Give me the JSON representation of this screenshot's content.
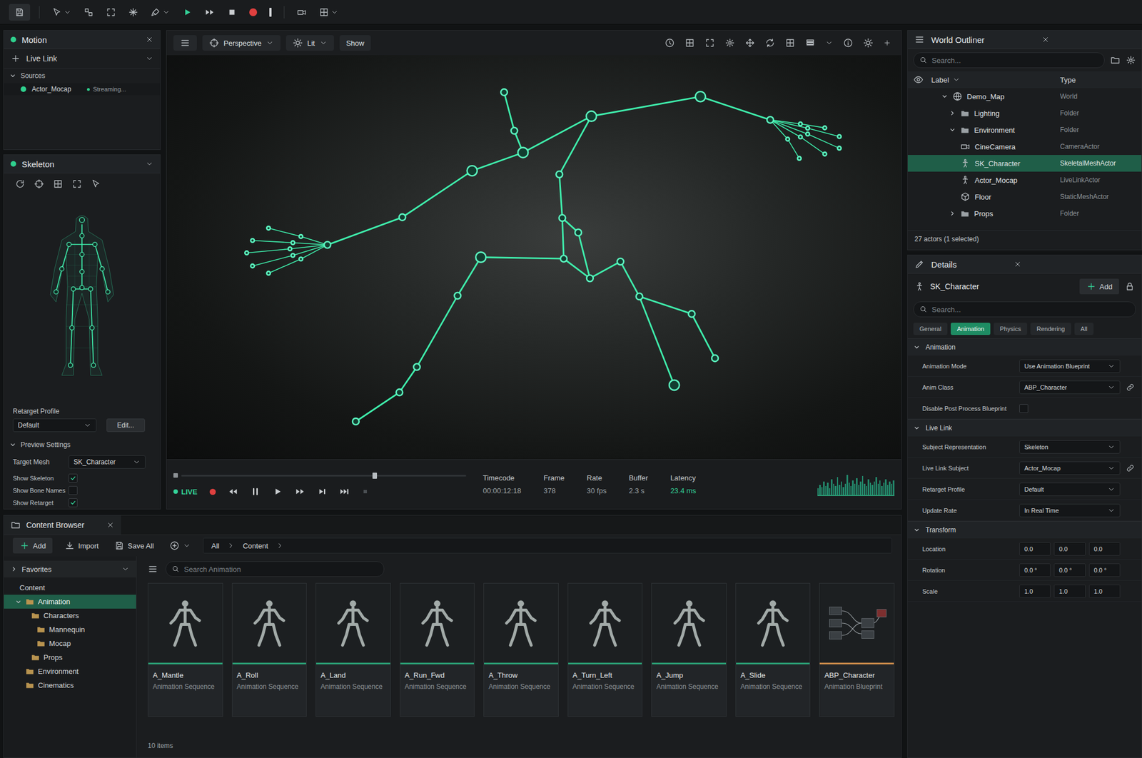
{
  "motion": {
    "title": "Motion",
    "live_link": "Live Link",
    "sources_title": "Sources",
    "sources_expanded": true,
    "sources": [
      {
        "name": "Actor_Mocap",
        "status": "Streaming...",
        "color": "#2fd18e"
      }
    ]
  },
  "skeleton": {
    "title": "Skeleton",
    "retarget_label": "Retarget Profile",
    "retarget_value": "Default",
    "edit_button": "Edit...",
    "preview_title": "Preview Settings",
    "preview_expanded": true,
    "target_mesh_label": "Target Mesh",
    "target_mesh": "SK_Character",
    "toggles": [
      {
        "label": "Show Skeleton",
        "checked": true
      },
      {
        "label": "Show Bone Names",
        "checked": false
      },
      {
        "label": "Show Retarget",
        "checked": true
      }
    ]
  },
  "viewport": {
    "view_mode": "Perspective",
    "lighting": "Lit",
    "show": "Show",
    "live_label": "LIVE",
    "live": true,
    "playhead": 0.68,
    "stats": [
      {
        "label": "Timecode",
        "value": "00:00:12:18",
        "highlight": false
      },
      {
        "label": "Frame",
        "value": "378",
        "highlight": false
      },
      {
        "label": "Rate",
        "value": "30 fps",
        "highlight": false
      },
      {
        "label": "Buffer",
        "value": "2.3 s",
        "highlight": false
      },
      {
        "label": "Latency",
        "value": "23.4 ms",
        "highlight": true
      }
    ],
    "activity": [
      0.3,
      0.45,
      0.35,
      0.6,
      0.4,
      0.55,
      0.3,
      0.7,
      0.5,
      0.4,
      0.8,
      0.45,
      0.6,
      0.35,
      0.5,
      0.9,
      0.55,
      0.4,
      0.65,
      0.5,
      0.75,
      0.45,
      0.6,
      0.85,
      0.5,
      0.4,
      0.7,
      0.55,
      0.45,
      0.6,
      0.8,
      0.5,
      0.65,
      0.4,
      0.55,
      0.7,
      0.45,
      0.6,
      0.5,
      0.65
    ]
  },
  "outliner": {
    "title": "World Outliner",
    "search_placeholder": "Search...",
    "columns": [
      "Label",
      "Type"
    ],
    "rows": [
      {
        "label": "Demo_Map",
        "type": "World",
        "kind": "world",
        "depth": 0,
        "expandable": true,
        "expanded": true,
        "selected": false
      },
      {
        "label": "Lighting",
        "type": "Folder",
        "kind": "folder",
        "depth": 1,
        "expandable": true,
        "expanded": false,
        "selected": false
      },
      {
        "label": "Environment",
        "type": "Folder",
        "kind": "folder",
        "depth": 1,
        "expandable": true,
        "expanded": true,
        "selected": false
      },
      {
        "label": "CineCamera",
        "type": "CameraActor",
        "kind": "camera",
        "depth": 1,
        "expandable": false,
        "expanded": false,
        "selected": false
      },
      {
        "label": "SK_Character",
        "type": "SkeletalMeshActor",
        "kind": "skeletal",
        "depth": 1,
        "expandable": false,
        "expanded": false,
        "selected": true
      },
      {
        "label": "Actor_Mocap",
        "type": "LiveLinkActor",
        "kind": "livelink",
        "depth": 1,
        "expandable": false,
        "expanded": false,
        "selected": false
      },
      {
        "label": "Floor",
        "type": "StaticMeshActor",
        "kind": "mesh",
        "depth": 1,
        "expandable": false,
        "expanded": false,
        "selected": false
      },
      {
        "label": "Props",
        "type": "Folder",
        "kind": "folder",
        "depth": 1,
        "expandable": true,
        "expanded": false,
        "selected": false
      }
    ],
    "footer": "27 actors (1 selected)"
  },
  "details": {
    "title": "Details",
    "actor": "SK_Character",
    "add_button": "Add",
    "search_placeholder": "Search...",
    "tabs": [
      {
        "label": "General",
        "selected": false
      },
      {
        "label": "Animation",
        "selected": true
      },
      {
        "label": "Physics",
        "selected": false
      },
      {
        "label": "Rendering",
        "selected": false
      },
      {
        "label": "All",
        "selected": false
      }
    ],
    "sections": [
      {
        "title": "Animation",
        "expanded": true,
        "rows": [
          {
            "label": "Animation Mode",
            "kind": "dropdown",
            "value": "Use Animation Blueprint",
            "link": false
          },
          {
            "label": "Anim Class",
            "kind": "dropdown",
            "value": "ABP_Character",
            "link": true
          },
          {
            "label": "Disable Post Process Blueprint",
            "kind": "checkbox",
            "checked": false
          }
        ]
      },
      {
        "title": "Live Link",
        "expanded": true,
        "rows": [
          {
            "label": "Subject Representation",
            "kind": "dropdown",
            "value": "Skeleton",
            "link": false
          },
          {
            "label": "Live Link Subject",
            "kind": "dropdown",
            "value": "Actor_Mocap",
            "link": true
          },
          {
            "label": "Retarget Profile",
            "kind": "dropdown",
            "value": "Default",
            "link": false
          },
          {
            "label": "Update Rate",
            "kind": "dropdown",
            "value": "In Real Time",
            "link": false
          }
        ]
      },
      {
        "title": "Transform",
        "expanded": true,
        "rows": [
          {
            "label": "Location",
            "kind": "vector",
            "values": [
              "0.0",
              "0.0",
              "0.0"
            ]
          },
          {
            "label": "Rotation",
            "kind": "vector",
            "values": [
              "0.0 °",
              "0.0 °",
              "0.0 °"
            ]
          },
          {
            "label": "Scale",
            "kind": "vector",
            "values": [
              "1.0",
              "1.0",
              "1.0"
            ]
          }
        ]
      }
    ]
  },
  "content_browser": {
    "title": "Content Browser",
    "add_button": "Add",
    "import_button": "Import",
    "save_button": "Save All",
    "breadcrumb": [
      "All",
      "Content"
    ],
    "search_placeholder": "Search Animation",
    "favorites": {
      "label": "Favorites",
      "expanded": false
    },
    "tree": [
      {
        "label": "Content",
        "depth": 0,
        "kind": "root",
        "expandable": false,
        "expanded": false,
        "selected": false
      },
      {
        "label": "Animation",
        "depth": 1,
        "kind": "folder",
        "expandable": true,
        "expanded": true,
        "selected": true
      },
      {
        "label": "Characters",
        "depth": 2,
        "kind": "folder",
        "expandable": false,
        "expanded": false,
        "selected": false
      },
      {
        "label": "Mannequin",
        "depth": 3,
        "kind": "folder",
        "expandable": false,
        "expanded": false,
        "selected": false
      },
      {
        "label": "Mocap",
        "depth": 3,
        "kind": "folder",
        "expandable": false,
        "expanded": false,
        "selected": false
      },
      {
        "label": "Props",
        "depth": 2,
        "kind": "folder",
        "expandable": false,
        "expanded": false,
        "selected": false
      },
      {
        "label": "Environment",
        "depth": 1,
        "kind": "folder",
        "expandable": false,
        "expanded": false,
        "selected": false
      },
      {
        "label": "Cinematics",
        "depth": 1,
        "kind": "folder",
        "expandable": false,
        "expanded": false,
        "selected": false
      }
    ],
    "assets": [
      {
        "name": "A_Mantle",
        "type": "Animation Sequence",
        "kind": "sequence",
        "color": "#2a9d74"
      },
      {
        "name": "A_Roll",
        "type": "Animation Sequence",
        "kind": "sequence",
        "color": "#2a9d74"
      },
      {
        "name": "A_Land",
        "type": "Animation Sequence",
        "kind": "sequence",
        "color": "#2a9d74"
      },
      {
        "name": "A_Run_Fwd",
        "type": "Animation Sequence",
        "kind": "sequence",
        "color": "#2a9d74"
      },
      {
        "name": "A_Throw",
        "type": "Animation Sequence",
        "kind": "sequence",
        "color": "#2a9d74"
      },
      {
        "name": "A_Turn_Left",
        "type": "Animation Sequence",
        "kind": "sequence",
        "color": "#2a9d74"
      },
      {
        "name": "A_Jump",
        "type": "Animation Sequence",
        "kind": "sequence",
        "color": "#2a9d74"
      },
      {
        "name": "A_Slide",
        "type": "Animation Sequence",
        "kind": "sequence",
        "color": "#2a9d74"
      },
      {
        "name": "ABP_Character",
        "type": "Animation Blueprint",
        "kind": "blueprint",
        "color": "#c8894a"
      }
    ],
    "count": "10 items"
  }
}
